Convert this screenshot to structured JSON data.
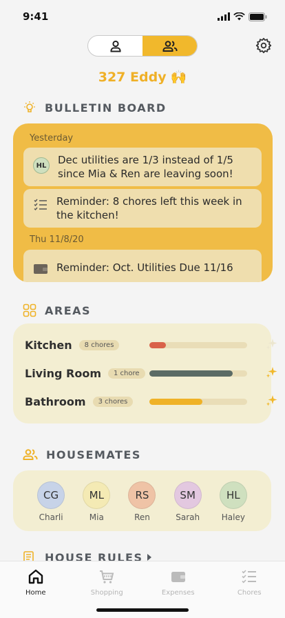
{
  "status": {
    "time": "9:41"
  },
  "header": {
    "house_name": "327 Eddy",
    "house_emoji": "🙌",
    "toggle": {
      "left_icon": "person-icon",
      "right_icon": "group-icon",
      "active": "group"
    }
  },
  "bulletin": {
    "title": "BULLETIN BOARD",
    "groups": [
      {
        "date": "Yesterday",
        "notes": [
          {
            "badge": "HL",
            "text": "Dec utilities are 1/3 instead of 1/5 since Mia & Ren are leaving soon!"
          },
          {
            "icon": "checklist-icon",
            "text": "Reminder: 8 chores left this week in the kitchen!"
          }
        ]
      },
      {
        "date": "Thu 11/8/20",
        "notes": [
          {
            "icon": "wallet-icon",
            "text": "Reminder: Oct. Utilities Due 11/16"
          }
        ]
      }
    ]
  },
  "areas": {
    "title": "AREAS",
    "items": [
      {
        "name": "Kitchen",
        "chores": "8 chores",
        "progress": 0.17,
        "color": "#d9624a",
        "sparkle": "#ece6cf"
      },
      {
        "name": "Living Room",
        "chores": "1 chore",
        "progress": 0.85,
        "color": "#5b6b65",
        "sparkle": "#f1b82c"
      },
      {
        "name": "Bathroom",
        "chores": "3 chores",
        "progress": 0.54,
        "color": "#efb227",
        "sparkle": "#f1b82c"
      }
    ]
  },
  "housemates": {
    "title": "HOUSEMATES",
    "people": [
      {
        "initials": "CG",
        "name": "Charli",
        "color": "#c7d3e8"
      },
      {
        "initials": "ML",
        "name": "Mia",
        "color": "#f4eab4"
      },
      {
        "initials": "RS",
        "name": "Ren",
        "color": "#efc3a6"
      },
      {
        "initials": "SM",
        "name": "Sarah",
        "color": "#e3c8e0"
      },
      {
        "initials": "HL",
        "name": "Haley",
        "color": "#cfe0bf"
      }
    ]
  },
  "house_rules": {
    "title": "HOUSE RULES"
  },
  "tabs": [
    {
      "label": "Home",
      "icon": "home-icon",
      "active": true
    },
    {
      "label": "Shopping",
      "icon": "cart-icon",
      "active": false
    },
    {
      "label": "Expenses",
      "icon": "wallet-icon",
      "active": false
    },
    {
      "label": "Chores",
      "icon": "checklist-icon",
      "active": false
    }
  ],
  "colors": {
    "accent": "#f1b82c",
    "bulletin_bg": "#f0bc46",
    "card_bg": "#f3eed2"
  }
}
